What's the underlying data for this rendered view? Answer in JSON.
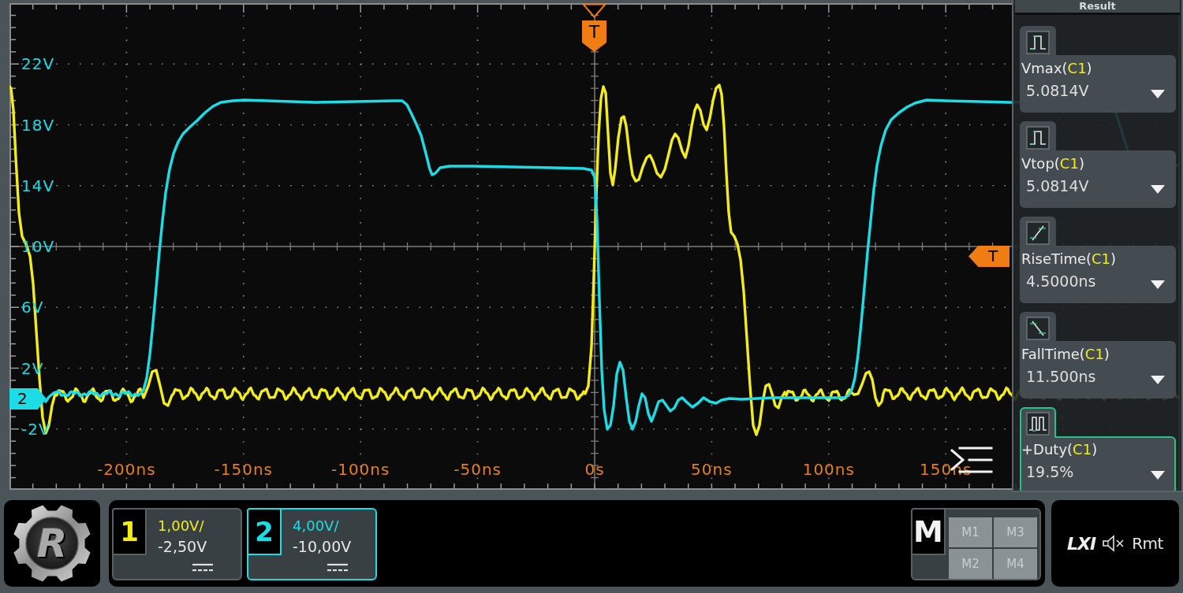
{
  "plot": {
    "voltage_labels": [
      "22V",
      "18V",
      "14V",
      "10V",
      "6V",
      "2V",
      "-2V"
    ],
    "time_labels": [
      "-200ns",
      "-150ns",
      "-100ns",
      "-50ns",
      "0s",
      "50ns",
      "100ns",
      "150ns"
    ],
    "channel_marker": "2",
    "trigger_position_marker": "T",
    "trigger_level_marker": "T"
  },
  "result_panel": {
    "title": "Result",
    "measurements": [
      {
        "kind": "pulse",
        "name": "Vmax(",
        "source": "C1",
        "name_end": ")",
        "value": "5.0814V",
        "selected": false
      },
      {
        "kind": "pulse",
        "name": "Vtop(",
        "source": "C1",
        "name_end": ")",
        "value": "5.0814V",
        "selected": false
      },
      {
        "kind": "rise",
        "name": "RiseTime(",
        "source": "C1",
        "name_end": ")",
        "value": "4.5000ns",
        "selected": false
      },
      {
        "kind": "fall",
        "name": "FallTime(",
        "source": "C1",
        "name_end": ")",
        "value": "11.500ns",
        "selected": false
      },
      {
        "kind": "duty",
        "name": "+Duty(",
        "source": "C1",
        "name_end": ")",
        "value": "19.5%",
        "selected": true
      }
    ]
  },
  "logo": {
    "letter": "R"
  },
  "channels": [
    {
      "number": "1",
      "color": "#f2ec1c",
      "scale": "1,00V/",
      "offset": "-2,50V",
      "selected": false
    },
    {
      "number": "2",
      "color": "#1cdce6",
      "scale": "4,00V/",
      "offset": "-10,00V",
      "selected": true
    }
  ],
  "math": {
    "label": "M",
    "buttons": [
      "M1",
      "M3",
      "M2",
      "M4"
    ]
  },
  "status": {
    "lxi": "LXI",
    "sound_muted": true,
    "remote": "Rmt"
  }
}
